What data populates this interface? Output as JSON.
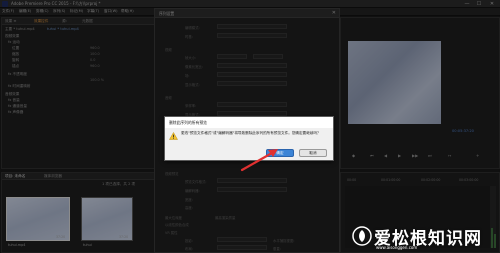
{
  "window": {
    "title": "Adobe Premiere Pro CC 2015 - F:\\\\方\\\\prproj *",
    "controls": [
      "—",
      "☐",
      "✕"
    ]
  },
  "menu": [
    "文件(F)",
    "编辑(E)",
    "剪辑(C)",
    "序列(S)",
    "标记(M)",
    "字幕(T)",
    "窗口(W)",
    "帮助(H)"
  ],
  "left_panel": {
    "tabs": [
      "效果控件",
      "源：",
      "元数据"
    ],
    "source_tab": "效果 ≡",
    "clip_label": "主要 * tuhui.mp4",
    "clip_label2": "tuhui * tuhui.mp4",
    "rows": [
      "视频效果",
      "fx 运动",
      "位置",
      "缩放",
      "旋转",
      "锚点",
      "fx 不透明度",
      "fx 时间重映射",
      "音频效果",
      "fx 音量",
      "fx 通道音量",
      "fx 声像器"
    ],
    "values": [
      "960.0",
      "100.0",
      "0.0",
      "960.0",
      "100.0 %",
      "0.0"
    ]
  },
  "project_panel": {
    "tabs": [
      "项目: 未命名",
      "媒体浏览器"
    ],
    "count_label": "1 项已选择，共 2 项",
    "items": [
      {
        "name": "tuhui.mp4",
        "duration": "37:20"
      },
      {
        "name": "tuhui",
        "duration": "37:20"
      }
    ]
  },
  "settings_dialog": {
    "title": "序列设置",
    "labels": [
      "编辑模式:",
      "时基:",
      "视频",
      "帧大小:",
      "像素长宽比:",
      "场:",
      "显示格式:",
      "音频",
      "采样率:",
      "显示格式:",
      "视频预览",
      "预览文件格式:",
      "编解码器:",
      "宽度:",
      "高度:",
      "最大位深度",
      "最高渲染质量",
      "以线性颜色合成",
      "VR 属性",
      "投影:",
      "布局:",
      "水平捕捉视图:",
      "垂直:"
    ]
  },
  "modal": {
    "title": "删除此序列的所有预览",
    "message": "更改\"预览文件格式\"或\"编解码器\"将导致删除此序列的所有预览文件。您确定要继续吗？",
    "confirm_label": "确定",
    "cancel_label": "取消"
  },
  "program_monitor": {
    "timecode": "00:05:37:20",
    "transport": [
      "◆",
      "⏮",
      "◀",
      "▶",
      "▶▶",
      "⏭",
      "↦",
      "+"
    ]
  },
  "timeline": {
    "ticks": [
      "00:00",
      "00:01:00:00",
      "00:02:00:00",
      "00:03:00:00"
    ]
  },
  "watermark": {
    "text": "爱松根知识网",
    "url": "www.aisonggen.com"
  },
  "colors": {
    "accent_blue": "#3c84d6",
    "annotation_red": "#e03030",
    "timecode_blue": "#4f7fc9"
  }
}
